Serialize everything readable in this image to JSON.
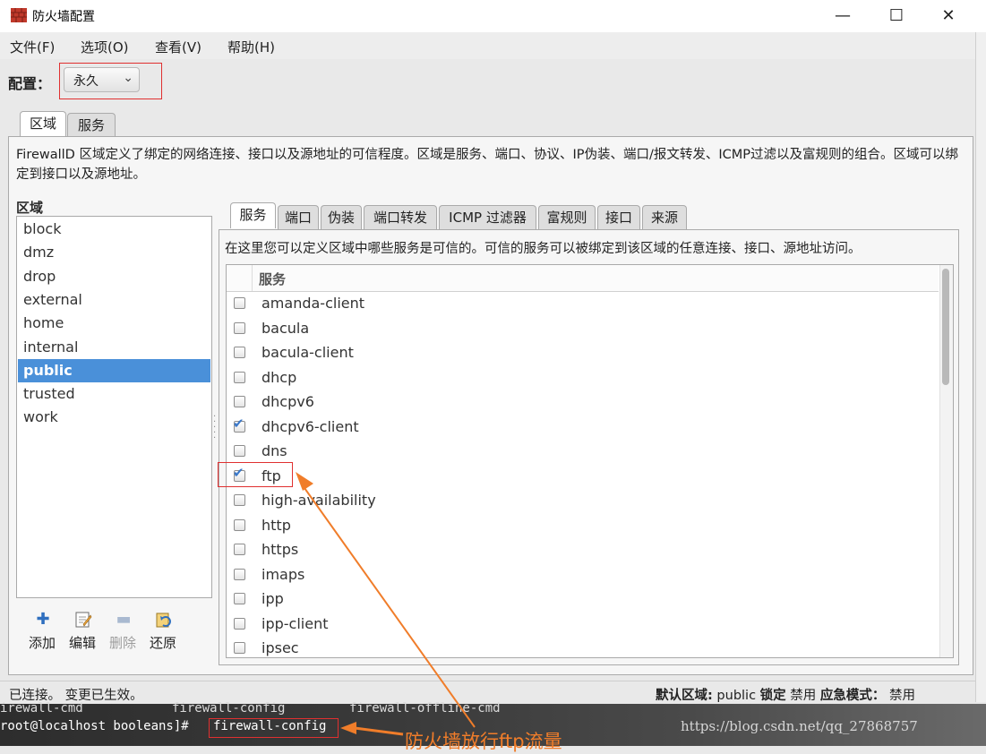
{
  "window": {
    "title": "防火墙配置",
    "controls": {
      "minimize": "—",
      "maximize": "☐",
      "close": "✕"
    }
  },
  "menu": [
    "文件(F)",
    "选项(O)",
    "查看(V)",
    "帮助(H)"
  ],
  "config": {
    "label": "配置：",
    "value": "永久"
  },
  "top_tabs": [
    {
      "label": "区域",
      "active": true
    },
    {
      "label": "服务",
      "active": false
    }
  ],
  "zone_description": "FirewallD 区域定义了绑定的网络连接、接口以及源地址的可信程度。区域是服务、端口、协议、IP伪装、端口/报文转发、ICMP过滤以及富规则的组合。区域可以绑定到接口以及源地址。",
  "zones": {
    "heading": "区域",
    "items": [
      "block",
      "dmz",
      "drop",
      "external",
      "home",
      "internal",
      "public",
      "trusted",
      "work"
    ],
    "selected": "public",
    "toolbar": [
      {
        "label": "添加",
        "icon": "add-icon",
        "enabled": true
      },
      {
        "label": "编辑",
        "icon": "edit-icon",
        "enabled": true
      },
      {
        "label": "删除",
        "icon": "remove-icon",
        "enabled": false
      },
      {
        "label": "还原",
        "icon": "restore-icon",
        "enabled": true
      }
    ]
  },
  "inner_tabs": [
    "服务",
    "端口",
    "伪装",
    "端口转发",
    "ICMP 过滤器",
    "富规则",
    "接口",
    "来源"
  ],
  "inner_active_tab": "服务",
  "services": {
    "description": "在这里您可以定义区域中哪些服务是可信的。可信的服务可以被绑定到该区域的任意连接、接口、源地址访问。",
    "column": "服务",
    "items": [
      {
        "name": "amanda-client",
        "checked": false
      },
      {
        "name": "bacula",
        "checked": false
      },
      {
        "name": "bacula-client",
        "checked": false
      },
      {
        "name": "dhcp",
        "checked": false
      },
      {
        "name": "dhcpv6",
        "checked": false
      },
      {
        "name": "dhcpv6-client",
        "checked": true
      },
      {
        "name": "dns",
        "checked": false
      },
      {
        "name": "ftp",
        "checked": true
      },
      {
        "name": "high-availability",
        "checked": false
      },
      {
        "name": "http",
        "checked": false
      },
      {
        "name": "https",
        "checked": false
      },
      {
        "name": "imaps",
        "checked": false
      },
      {
        "name": "ipp",
        "checked": false
      },
      {
        "name": "ipp-client",
        "checked": false
      },
      {
        "name": "ipsec",
        "checked": false
      }
    ]
  },
  "status": {
    "left": "已连接。 变更已生效。",
    "default_zone_label": "默认区域:",
    "default_zone": "public",
    "lockdown_label": "锁定",
    "lockdown": "禁用",
    "panic_label": "应急模式：",
    "panic": "禁用"
  },
  "terminal": {
    "line1": [
      "irewall-cmd",
      "firewall-config",
      "firewall-offline-cmd"
    ],
    "prompt": "root@localhost booleans]#",
    "command": "firewall-config",
    "watermark": "https://blog.csdn.net/qq_27868757"
  },
  "annotation": {
    "text": "防火墙放行ftp流量",
    "color": "#f07d2a"
  },
  "colors": {
    "selection": "#4a90d9",
    "highlight_box": "#e03030",
    "annotation": "#f07d2a"
  }
}
